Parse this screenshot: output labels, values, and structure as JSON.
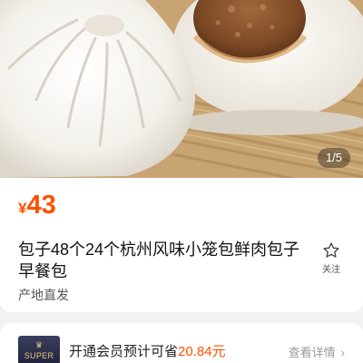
{
  "gallery": {
    "counter": "1/5"
  },
  "product": {
    "currency": "¥",
    "price": "43",
    "title": "包子48个24个杭州风味小笼包鲜肉包子早餐包",
    "favorite_label": "关注",
    "origin_tag": "产地直发"
  },
  "membership": {
    "badge_text": "SUPER",
    "promo_prefix": "开通会员预计可省",
    "promo_amount": "20.84元",
    "details_label": "查看详情",
    "chevron": "›"
  },
  "colors": {
    "price": "#ff5000",
    "background": "#f2f2f2"
  }
}
